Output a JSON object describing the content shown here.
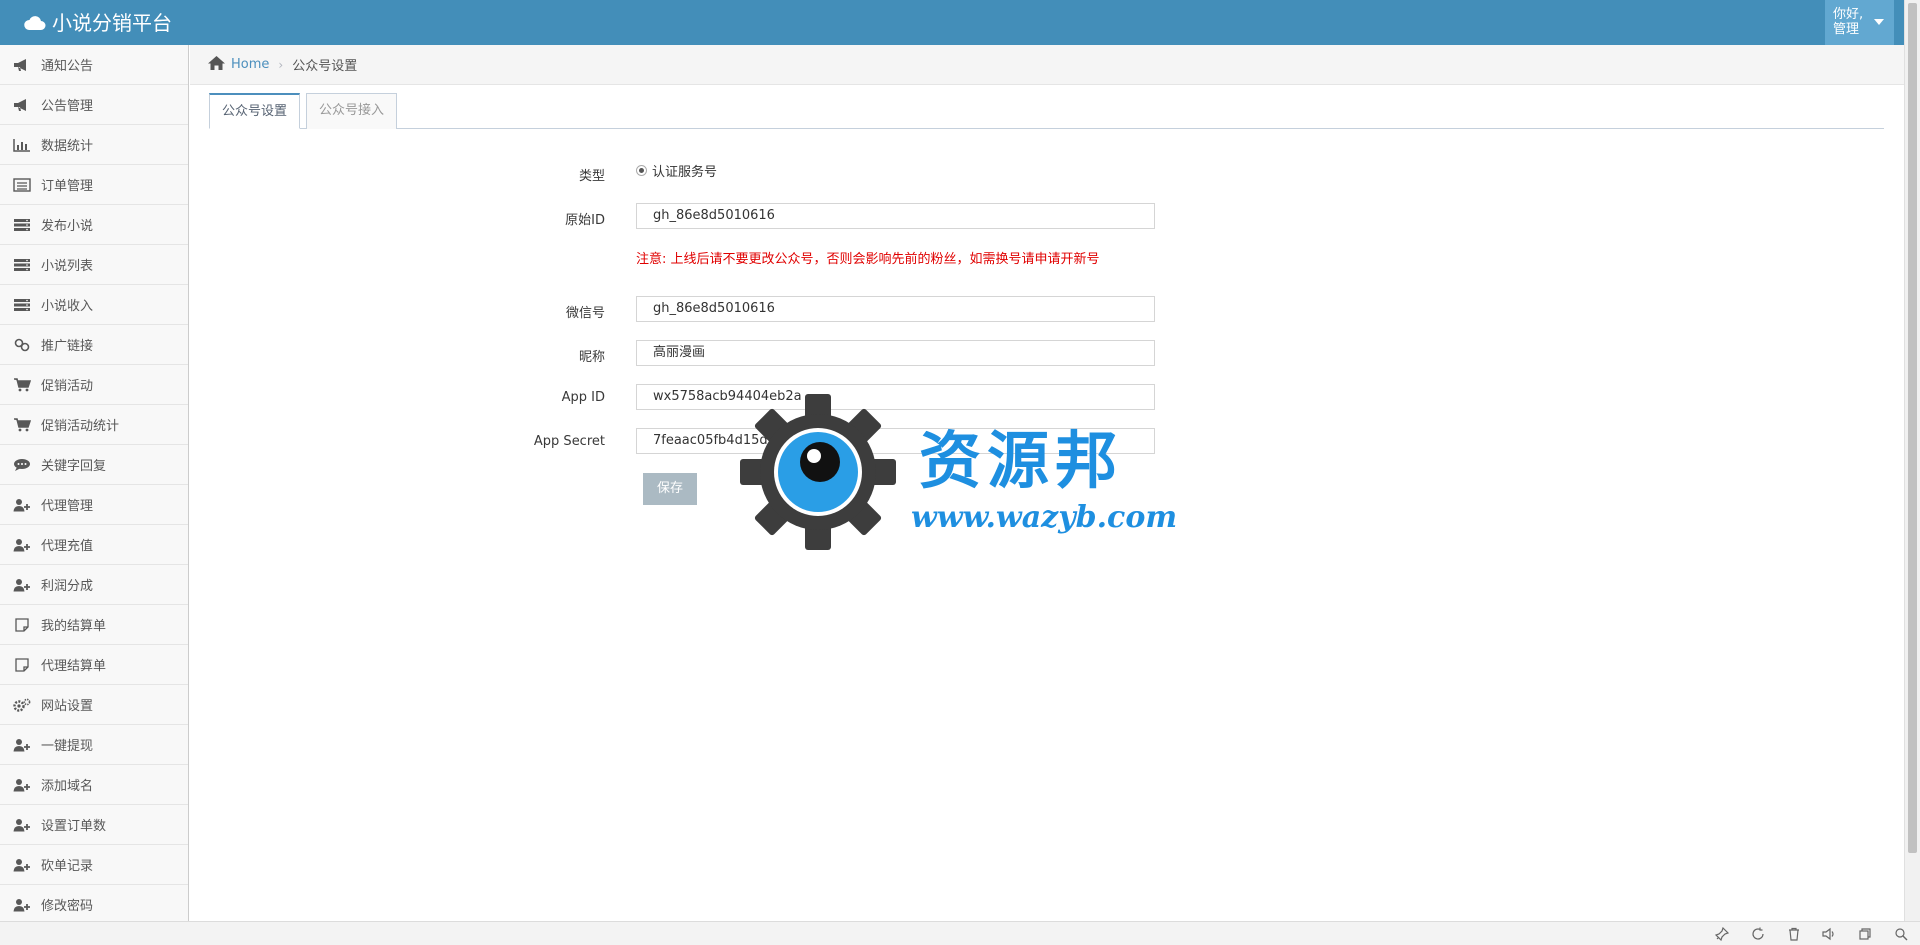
{
  "navbar": {
    "brand": "小说分销平台",
    "user_greeting": "你好,",
    "user_name": "管理"
  },
  "sidebar": {
    "items": [
      {
        "label": "通知公告",
        "icon": "bullhorn-icon"
      },
      {
        "label": "公告管理",
        "icon": "bullhorn-icon"
      },
      {
        "label": "数据统计",
        "icon": "bar-chart-icon"
      },
      {
        "label": "订单管理",
        "icon": "list-alt-icon"
      },
      {
        "label": "发布小说",
        "icon": "server-icon"
      },
      {
        "label": "小说列表",
        "icon": "server-icon"
      },
      {
        "label": "小说收入",
        "icon": "server-icon"
      },
      {
        "label": "推广链接",
        "icon": "link-icon"
      },
      {
        "label": "促销活动",
        "icon": "cart-icon"
      },
      {
        "label": "促销活动统计",
        "icon": "cart-icon"
      },
      {
        "label": "关键字回复",
        "icon": "comments-icon"
      },
      {
        "label": "代理管理",
        "icon": "user-add-icon"
      },
      {
        "label": "代理充值",
        "icon": "user-add-icon"
      },
      {
        "label": "利润分成",
        "icon": "user-add-icon"
      },
      {
        "label": "我的结算单",
        "icon": "note-icon"
      },
      {
        "label": "代理结算单",
        "icon": "note-icon"
      },
      {
        "label": "网站设置",
        "icon": "cogs-icon"
      },
      {
        "label": "一键提现",
        "icon": "user-add-icon"
      },
      {
        "label": "添加域名",
        "icon": "user-add-icon"
      },
      {
        "label": "设置订单数",
        "icon": "user-add-icon"
      },
      {
        "label": "砍单记录",
        "icon": "user-add-icon"
      },
      {
        "label": "修改密码",
        "icon": "user-add-icon"
      }
    ]
  },
  "breadcrumb": {
    "home": "Home",
    "current": "公众号设置"
  },
  "tabs": [
    {
      "label": "公众号设置",
      "active": true
    },
    {
      "label": "公众号接入",
      "active": false
    }
  ],
  "form": {
    "type_label": "类型",
    "type_value": "认证服务号",
    "original_id_label": "原始ID",
    "original_id_value": "gh_86e8d5010616",
    "warning": "注意: 上线后请不要更改公众号，否则会影响先前的粉丝，如需换号请申请开新号",
    "wechat_label": "微信号",
    "wechat_value": "gh_86e8d5010616",
    "nickname_label": "昵称",
    "nickname_value": "高丽漫画",
    "appid_label": "App ID",
    "appid_value": "wx5758acb94404eb2a",
    "secret_label": "App Secret",
    "secret_value": "7feaac05fb4d15d3a      2d3cd230",
    "save_label": "保存"
  },
  "watermark": {
    "cn": "资源邦",
    "url": "www.wazyb.com"
  },
  "colors": {
    "navbar": "#438eb9",
    "link": "#4c8fbd",
    "warning": "#e00000",
    "button": "#abbac3",
    "watermark": "#1e8fe0"
  }
}
